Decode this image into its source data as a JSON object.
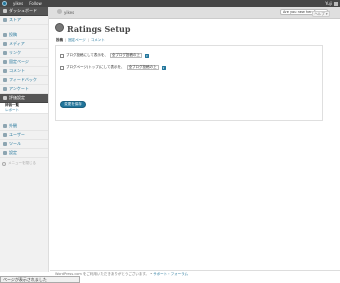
{
  "adminbar": {
    "site_name": "yikes",
    "follow_label": "Follow",
    "user_label": "Yuji"
  },
  "header": {
    "site_name": "yikes",
    "search_placeholder": "Are you new here?",
    "help_label": "ヘルプ ▾"
  },
  "sidebar": {
    "items": [
      {
        "label": "ダッシュボード"
      },
      {
        "label": "ストア"
      },
      {
        "label": "投稿"
      },
      {
        "label": "メディア"
      },
      {
        "label": "リンク"
      },
      {
        "label": "固定ページ"
      },
      {
        "label": "コメント"
      },
      {
        "label": "フィードバック"
      },
      {
        "label": "アンケート"
      },
      {
        "label": "評価設定"
      },
      {
        "label": "外観"
      },
      {
        "label": "ユーザー"
      },
      {
        "label": "ツール"
      },
      {
        "label": "設定"
      }
    ],
    "submenu": [
      {
        "label": "評価一覧"
      },
      {
        "label": "レポート"
      }
    ],
    "collapse_label": "メニューを閉じる"
  },
  "main": {
    "title": "Ratings Setup",
    "tabs": [
      {
        "label": "投稿"
      },
      {
        "label": "固定ページ"
      },
      {
        "label": "コメント"
      }
    ],
    "options": [
      {
        "label": "ブログ投稿にして表示を、",
        "select": "全ブログ投稿の上"
      },
      {
        "label": "ブログページ(トップ)にして表示を、",
        "select": "全ブログ投稿の上"
      }
    ],
    "save_label": "変更を保存"
  },
  "footer": {
    "text": "WordPress.com をご利用いただきありがとうございます。",
    "link": "サポート・フォーラム"
  },
  "statusbar": {
    "text": "ページが表示されました"
  },
  "colors": {
    "accent": "#21759b",
    "adminbar": "#464646",
    "current_menu": "#555555"
  }
}
